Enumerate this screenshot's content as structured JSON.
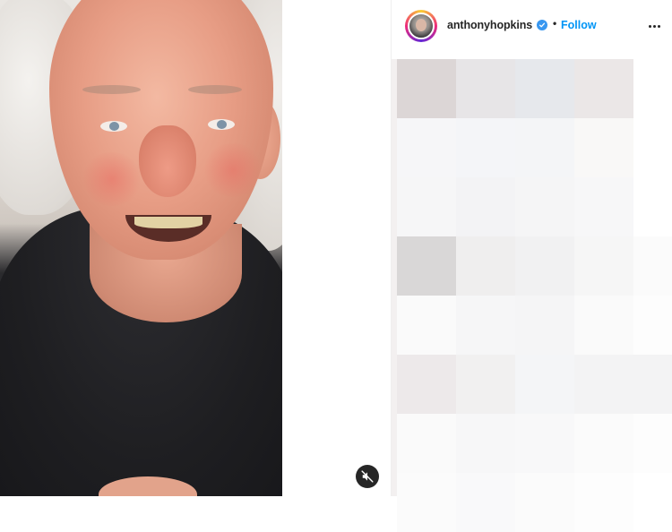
{
  "post": {
    "media": {
      "sound_state": "muted",
      "mute_icon": "speaker-muted-icon"
    },
    "header": {
      "username": "anthonyhopkins",
      "verified_icon": "verified-badge-icon",
      "separator": "•",
      "follow_label": "Follow",
      "more_icon": "more-options-icon"
    },
    "blurred_content": {
      "note_colors": [
        "#e3dcdc",
        "#ebe9eb",
        "#e8eaee",
        "#ede9e9",
        "#f4f4f6"
      ]
    }
  },
  "colors": {
    "follow_blue": "#0095f6",
    "verified_blue": "#3897f0",
    "text_dark": "#262626"
  }
}
